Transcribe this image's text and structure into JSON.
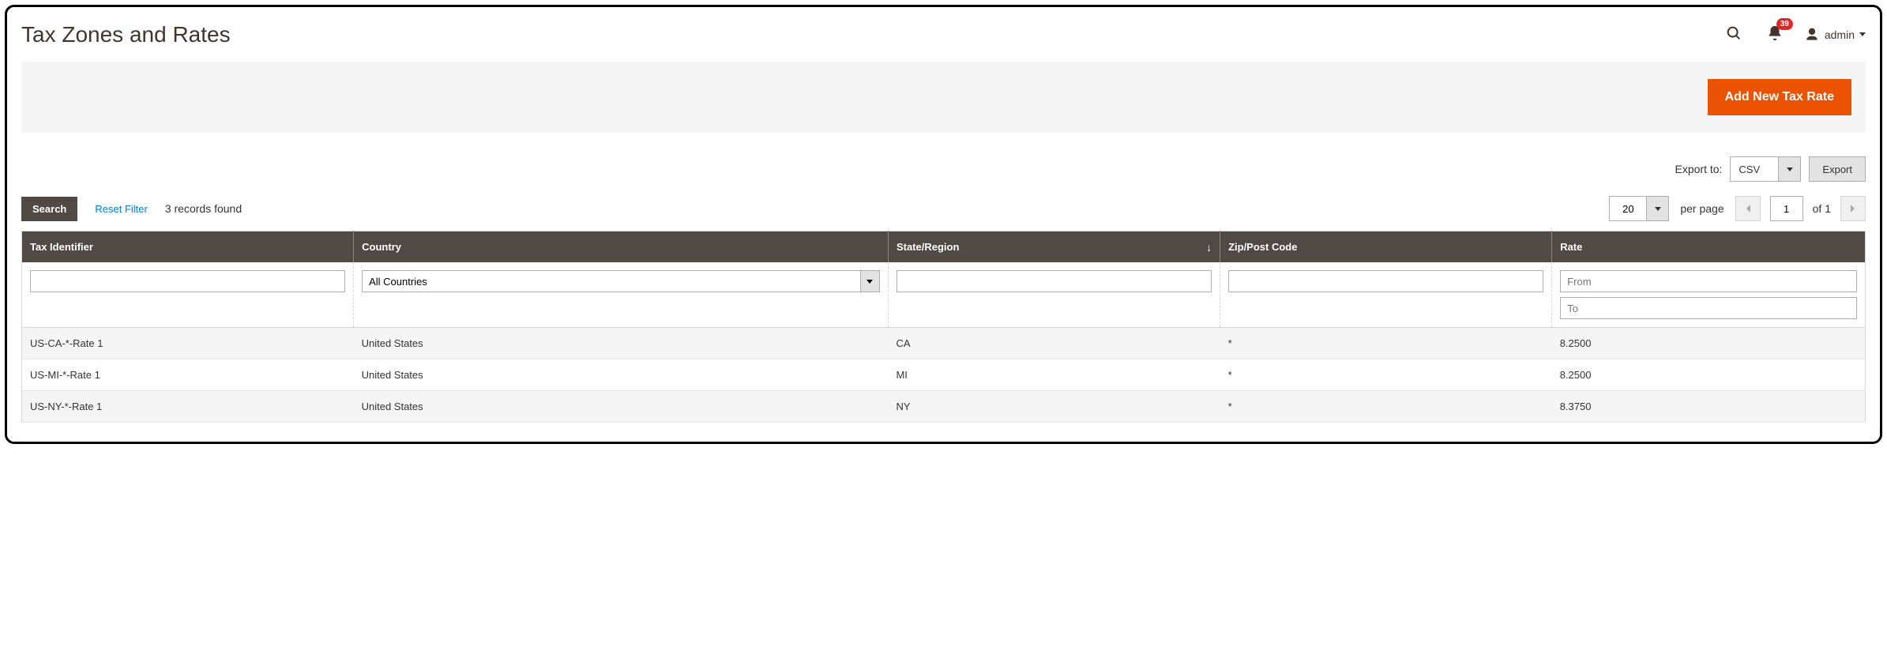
{
  "header": {
    "title": "Tax Zones and Rates",
    "notification_count": "39",
    "user_label": "admin"
  },
  "actions": {
    "add_new": "Add New Tax Rate"
  },
  "export": {
    "label": "Export to:",
    "selected": "CSV",
    "button": "Export"
  },
  "toolbar": {
    "search_label": "Search",
    "reset_label": "Reset Filter",
    "records_found": "3 records found",
    "per_page_value": "20",
    "per_page_label": "per page",
    "current_page": "1",
    "of_pages": "of 1"
  },
  "table": {
    "columns": [
      "Tax Identifier",
      "Country",
      "State/Region",
      "Zip/Post Code",
      "Rate"
    ],
    "filters": {
      "country": "All Countries",
      "rate_from_placeholder": "From",
      "rate_to_placeholder": "To"
    },
    "rows": [
      {
        "tax_identifier": "US-CA-*-Rate 1",
        "country": "United States",
        "state": "CA",
        "zip": "*",
        "rate": "8.2500"
      },
      {
        "tax_identifier": "US-MI-*-Rate 1",
        "country": "United States",
        "state": "MI",
        "zip": "*",
        "rate": "8.2500"
      },
      {
        "tax_identifier": "US-NY-*-Rate 1",
        "country": "United States",
        "state": "NY",
        "zip": "*",
        "rate": "8.3750"
      }
    ]
  }
}
